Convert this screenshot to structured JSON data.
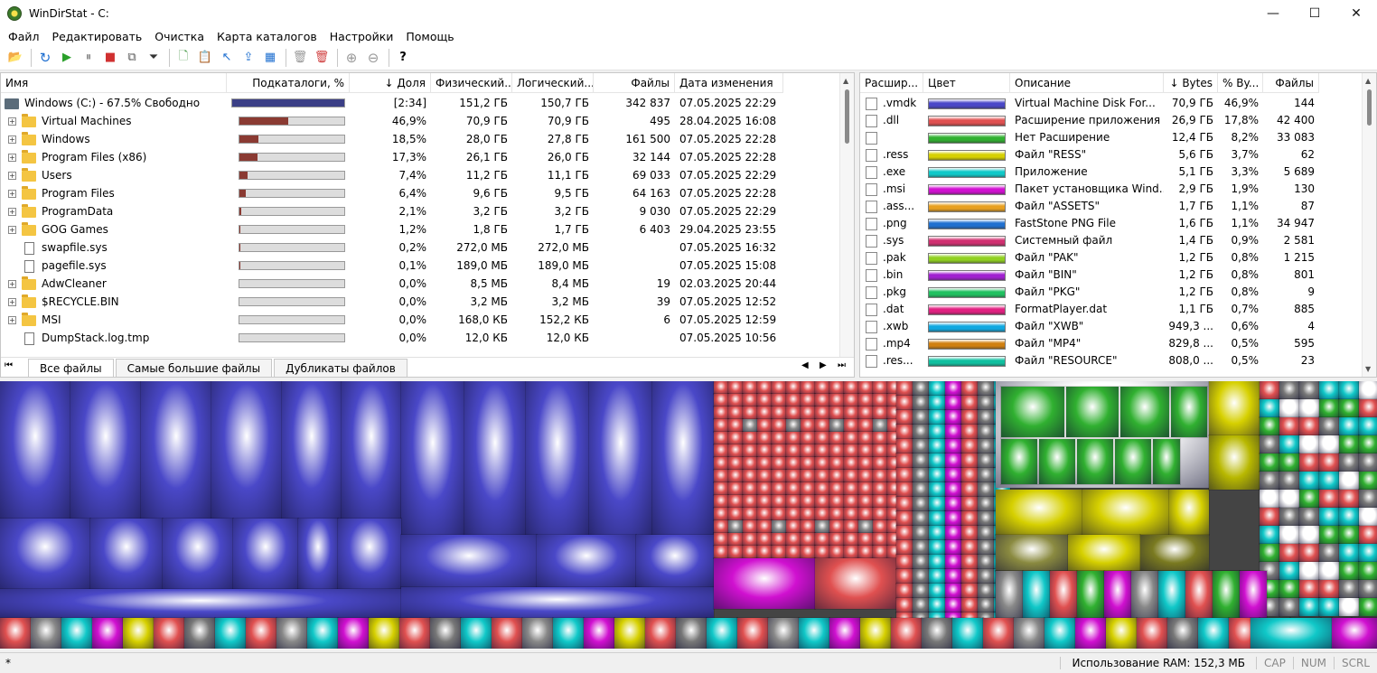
{
  "window": {
    "title": "WinDirStat - C:",
    "minimize": "—",
    "maximize": "☐",
    "close": "✕"
  },
  "menu": [
    "Файл",
    "Редактировать",
    "Очистка",
    "Карта каталогов",
    "Настройки",
    "Помощь"
  ],
  "toolbar": {
    "open": "📂",
    "refresh": "↻",
    "play": "▶",
    "pause": "⏸",
    "stop": "■",
    "copy": "⧉",
    "filter": "⏷",
    "new": "🗋",
    "paste": "📋",
    "pointer": "↖",
    "export": "⇪",
    "zoom_tree": "▦",
    "delete": "🗑",
    "delete_perm": "🗑",
    "zoom_in": "⊕",
    "zoom_out": "⊖",
    "help": "?"
  },
  "left": {
    "headers": [
      "Имя",
      "Подкаталоги, %",
      "↓ Доля",
      "Физический...",
      "Логический...",
      "Файлы",
      "Дата изменения"
    ],
    "rows": [
      {
        "name": "Windows (C:) - 67.5% Свободно",
        "type": "drive",
        "pct": 100,
        "share": "[2:34]",
        "phys": "151,2 ГБ",
        "log": "150,7 ГБ",
        "files": "342 837",
        "date": "07.05.2025  22:29"
      },
      {
        "name": "Virtual Machines",
        "type": "folder",
        "pct": 46.9,
        "share": "46,9%",
        "phys": "70,9 ГБ",
        "log": "70,9 ГБ",
        "files": "495",
        "date": "28.04.2025  16:08"
      },
      {
        "name": "Windows",
        "type": "folder",
        "pct": 18.5,
        "share": "18,5%",
        "phys": "28,0 ГБ",
        "log": "27,8 ГБ",
        "files": "161 500",
        "date": "07.05.2025  22:28"
      },
      {
        "name": "Program Files (x86)",
        "type": "folder",
        "pct": 17.3,
        "share": "17,3%",
        "phys": "26,1 ГБ",
        "log": "26,0 ГБ",
        "files": "32 144",
        "date": "07.05.2025  22:28"
      },
      {
        "name": "Users",
        "type": "folder",
        "pct": 7.4,
        "share": "7,4%",
        "phys": "11,2 ГБ",
        "log": "11,1 ГБ",
        "files": "69 033",
        "date": "07.05.2025  22:29"
      },
      {
        "name": "Program Files",
        "type": "folder",
        "pct": 6.4,
        "share": "6,4%",
        "phys": "9,6 ГБ",
        "log": "9,5 ГБ",
        "files": "64 163",
        "date": "07.05.2025  22:28"
      },
      {
        "name": "ProgramData",
        "type": "folder",
        "pct": 2.1,
        "share": "2,1%",
        "phys": "3,2 ГБ",
        "log": "3,2 ГБ",
        "files": "9 030",
        "date": "07.05.2025  22:29"
      },
      {
        "name": "GOG Games",
        "type": "folder",
        "pct": 1.2,
        "share": "1,2%",
        "phys": "1,8 ГБ",
        "log": "1,7 ГБ",
        "files": "6 403",
        "date": "29.04.2025  23:55"
      },
      {
        "name": "swapfile.sys",
        "type": "file",
        "pct": 0.2,
        "share": "0,2%",
        "phys": "272,0 МБ",
        "log": "272,0 МБ",
        "files": "",
        "date": "07.05.2025  16:32"
      },
      {
        "name": "pagefile.sys",
        "type": "file",
        "pct": 0.1,
        "share": "0,1%",
        "phys": "189,0 МБ",
        "log": "189,0 МБ",
        "files": "",
        "date": "07.05.2025  15:08"
      },
      {
        "name": "AdwCleaner",
        "type": "folder",
        "pct": 0,
        "share": "0,0%",
        "phys": "8,5 МБ",
        "log": "8,4 МБ",
        "files": "19",
        "date": "02.03.2025  20:44"
      },
      {
        "name": "$RECYCLE.BIN",
        "type": "folder",
        "pct": 0,
        "share": "0,0%",
        "phys": "3,2 МБ",
        "log": "3,2 МБ",
        "files": "39",
        "date": "07.05.2025  12:52"
      },
      {
        "name": "MSI",
        "type": "folder",
        "pct": 0,
        "share": "0,0%",
        "phys": "168,0 КБ",
        "log": "152,2 КБ",
        "files": "6",
        "date": "07.05.2025  12:59"
      },
      {
        "name": "DumpStack.log.tmp",
        "type": "file",
        "pct": 0,
        "share": "0,0%",
        "phys": "12,0 КБ",
        "log": "12,0 КБ",
        "files": "",
        "date": "07.05.2025  10:56"
      }
    ],
    "tabs": [
      "Все файлы",
      "Самые большие файлы",
      "Дубликаты файлов"
    ]
  },
  "right": {
    "headers": [
      "Расшир...",
      "Цвет",
      "Описание",
      "↓ Bytes",
      "% By...",
      "Файлы"
    ],
    "rows": [
      {
        "ext": ".vmdk",
        "color": "#4a48c8",
        "desc": "Virtual Machine Disk For...",
        "bytes": "70,9 ГБ",
        "pct": "46,9%",
        "files": "144"
      },
      {
        "ext": ".dll",
        "color": "#e05050",
        "desc": "Расширение приложения",
        "bytes": "26,9 ГБ",
        "pct": "17,8%",
        "files": "42 400"
      },
      {
        "ext": "",
        "color": "#30b030",
        "desc": "Нет Расширение",
        "bytes": "12,4 ГБ",
        "pct": "8,2%",
        "files": "33 083"
      },
      {
        "ext": ".ress",
        "color": "#d6d000",
        "desc": "Файл \"RESS\"",
        "bytes": "5,6 ГБ",
        "pct": "3,7%",
        "files": "62"
      },
      {
        "ext": ".exe",
        "color": "#10c8c8",
        "desc": "Приложение",
        "bytes": "5,1 ГБ",
        "pct": "3,3%",
        "files": "5 689"
      },
      {
        "ext": ".msi",
        "color": "#d010d0",
        "desc": "Пакет установщика Wind...",
        "bytes": "2,9 ГБ",
        "pct": "1,9%",
        "files": "130"
      },
      {
        "ext": ".ass...",
        "color": "#e8a020",
        "desc": "Файл \"ASSETS\"",
        "bytes": "1,7 ГБ",
        "pct": "1,1%",
        "files": "87"
      },
      {
        "ext": ".png",
        "color": "#2070d0",
        "desc": "FastStone PNG File",
        "bytes": "1,6 ГБ",
        "pct": "1,1%",
        "files": "34 947"
      },
      {
        "ext": ".sys",
        "color": "#d03070",
        "desc": "Системный файл",
        "bytes": "1,4 ГБ",
        "pct": "0,9%",
        "files": "2 581"
      },
      {
        "ext": ".pak",
        "color": "#90d020",
        "desc": "Файл \"PAK\"",
        "bytes": "1,2 ГБ",
        "pct": "0,8%",
        "files": "1 215"
      },
      {
        "ext": ".bin",
        "color": "#a020d0",
        "desc": "Файл \"BIN\"",
        "bytes": "1,2 ГБ",
        "pct": "0,8%",
        "files": "801"
      },
      {
        "ext": ".pkg",
        "color": "#20c060",
        "desc": "Файл \"PKG\"",
        "bytes": "1,2 ГБ",
        "pct": "0,8%",
        "files": "9"
      },
      {
        "ext": ".dat",
        "color": "#e02080",
        "desc": "FormatPlayer.dat",
        "bytes": "1,1 ГБ",
        "pct": "0,7%",
        "files": "885"
      },
      {
        "ext": ".xwb",
        "color": "#10a8e0",
        "desc": "Файл \"XWB\"",
        "bytes": "949,3 ...",
        "pct": "0,6%",
        "files": "4"
      },
      {
        "ext": ".mp4",
        "color": "#d08010",
        "desc": "Файл \"MP4\"",
        "bytes": "829,8 ...",
        "pct": "0,5%",
        "files": "595"
      },
      {
        "ext": ".res...",
        "color": "#10c0a0",
        "desc": "Файл \"RESOURCE\"",
        "bytes": "808,0 ...",
        "pct": "0,5%",
        "files": "23"
      }
    ]
  },
  "status": {
    "left": "*",
    "ram": "Использование RAM: 152,3 МБ",
    "keys": [
      "CAP",
      "NUM",
      "SCRL"
    ]
  }
}
